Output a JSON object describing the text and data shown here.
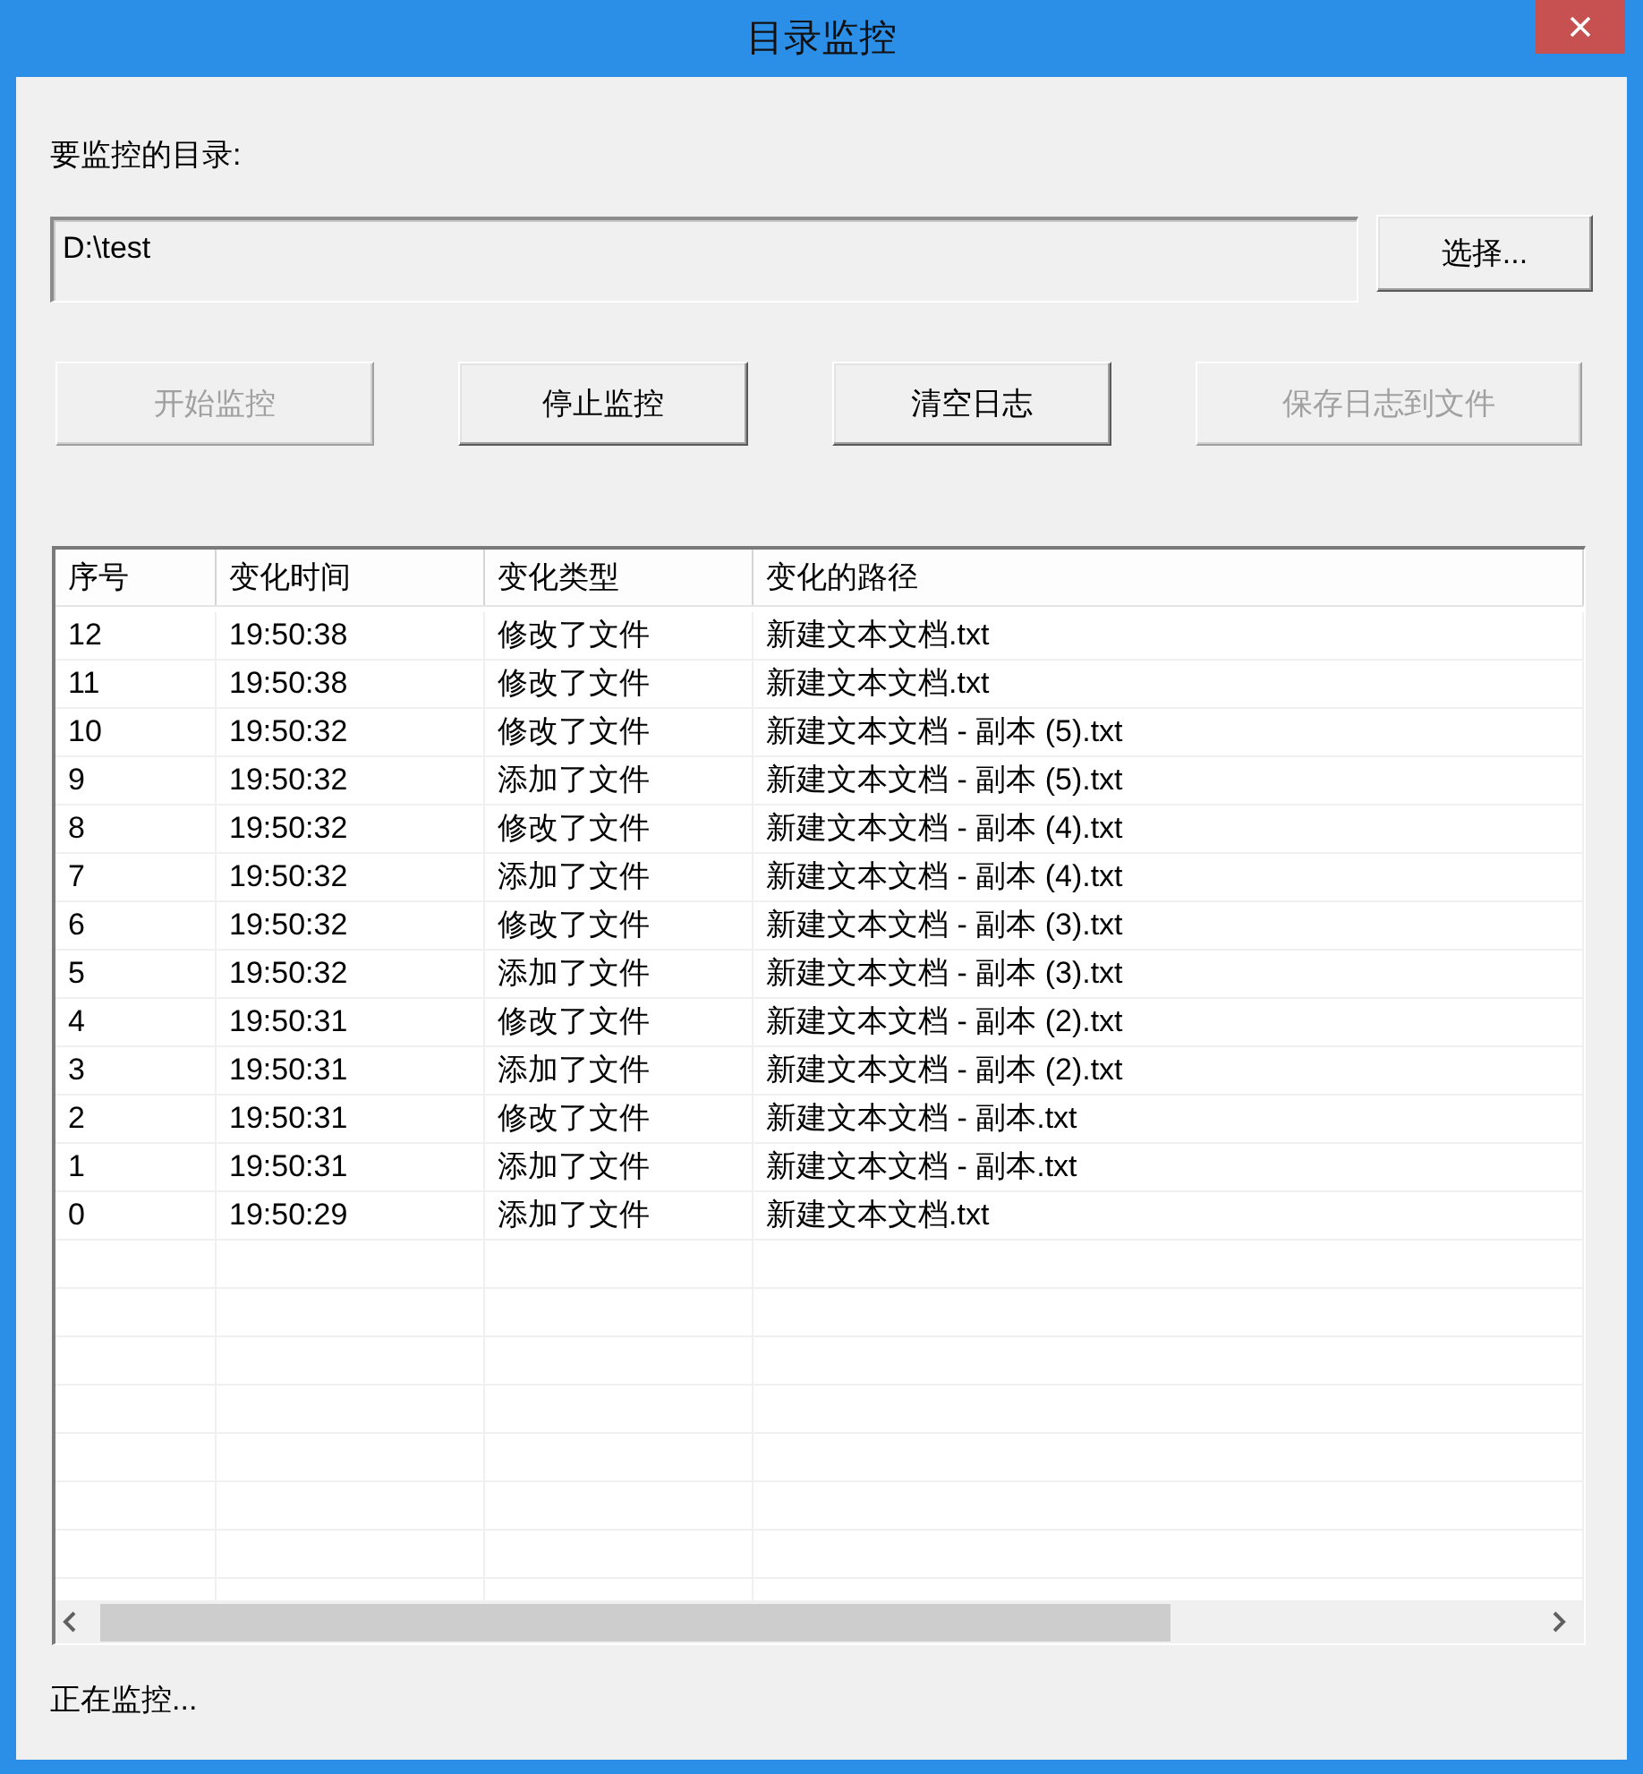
{
  "window": {
    "title": "目录监控"
  },
  "directory": {
    "label": "要监控的目录:",
    "value": "D:\\test",
    "browse_button": "选择..."
  },
  "buttons": [
    {
      "label": "开始监控",
      "disabled": true
    },
    {
      "label": "停止监控",
      "disabled": false
    },
    {
      "label": "清空日志",
      "disabled": false
    },
    {
      "label": "保存日志到文件",
      "disabled": true
    }
  ],
  "table": {
    "columns": [
      "序号",
      "变化时间",
      "变化类型",
      "变化的路径"
    ],
    "rows": [
      [
        "12",
        "19:50:38",
        "修改了文件",
        "新建文本文档.txt"
      ],
      [
        "11",
        "19:50:38",
        "修改了文件",
        "新建文本文档.txt"
      ],
      [
        "10",
        "19:50:32",
        "修改了文件",
        "新建文本文档 - 副本 (5).txt"
      ],
      [
        "9",
        "19:50:32",
        "添加了文件",
        "新建文本文档 - 副本 (5).txt"
      ],
      [
        "8",
        "19:50:32",
        "修改了文件",
        "新建文本文档 - 副本 (4).txt"
      ],
      [
        "7",
        "19:50:32",
        "添加了文件",
        "新建文本文档 - 副本 (4).txt"
      ],
      [
        "6",
        "19:50:32",
        "修改了文件",
        "新建文本文档 - 副本 (3).txt"
      ],
      [
        "5",
        "19:50:32",
        "添加了文件",
        "新建文本文档 - 副本 (3).txt"
      ],
      [
        "4",
        "19:50:31",
        "修改了文件",
        "新建文本文档 - 副本 (2).txt"
      ],
      [
        "3",
        "19:50:31",
        "添加了文件",
        "新建文本文档 - 副本 (2).txt"
      ],
      [
        "2",
        "19:50:31",
        "修改了文件",
        "新建文本文档 - 副本.txt"
      ],
      [
        "1",
        "19:50:31",
        "添加了文件",
        "新建文本文档 - 副本.txt"
      ],
      [
        "0",
        "19:50:29",
        "添加了文件",
        "新建文本文档.txt"
      ]
    ]
  },
  "status_bar": "正在监控..."
}
